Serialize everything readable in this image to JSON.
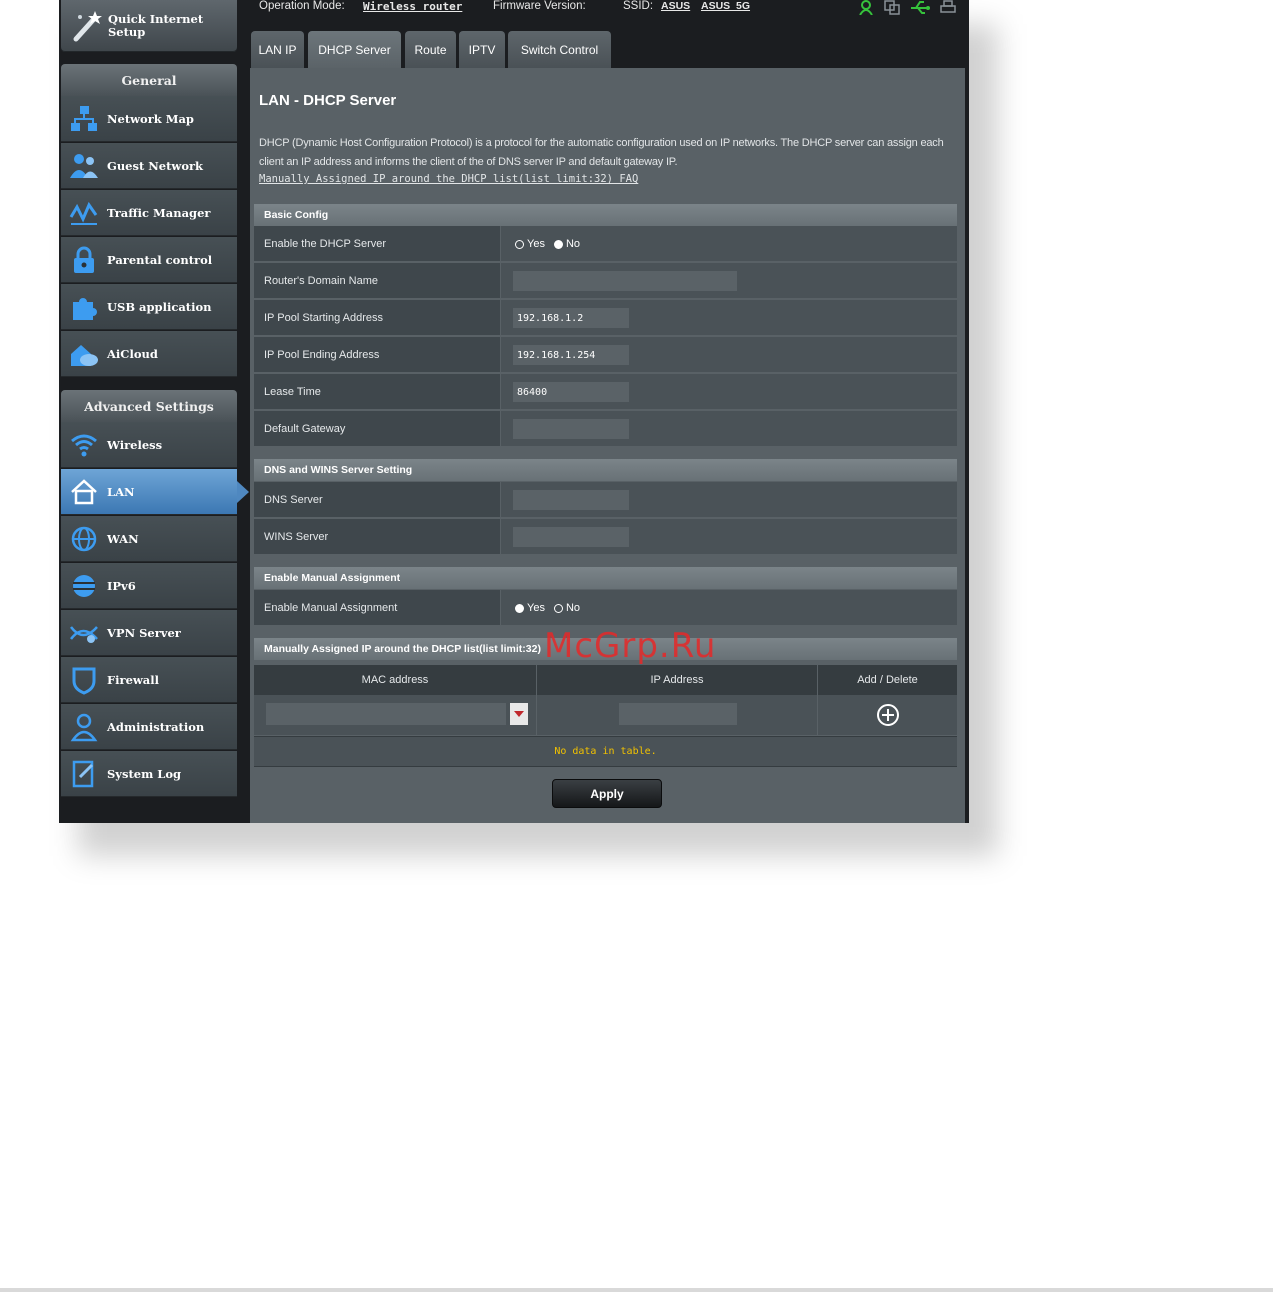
{
  "status_bar": {
    "operation_mode_label": "Operation Mode:",
    "operation_mode_value": "Wireless router",
    "firmware_label": "Firmware Version:",
    "ssid_label": "SSID:",
    "ssid_1": "ASUS",
    "ssid_2": "ASUS_5G",
    "icons": [
      "user-status-icon",
      "copy-status-icon",
      "usb-status-icon",
      "printer-status-icon"
    ],
    "usb_color": "#36c23c"
  },
  "sidebar": {
    "quick_setup_label": "Quick Internet Setup",
    "general_header": "General",
    "general_items": [
      {
        "label": "Network Map",
        "icon": "network-map-icon"
      },
      {
        "label": "Guest Network",
        "icon": "guest-network-icon"
      },
      {
        "label": "Traffic Manager",
        "icon": "traffic-manager-icon"
      },
      {
        "label": "Parental control",
        "icon": "lock-icon"
      },
      {
        "label": "USB application",
        "icon": "puzzle-icon"
      },
      {
        "label": "AiCloud",
        "icon": "cloud-icon"
      }
    ],
    "advanced_header": "Advanced Settings",
    "advanced_items": [
      {
        "label": "Wireless",
        "icon": "wireless-icon"
      },
      {
        "label": "LAN",
        "icon": "home-icon",
        "active": true
      },
      {
        "label": "WAN",
        "icon": "globe-icon"
      },
      {
        "label": "IPv6",
        "icon": "ipv6-globe-icon"
      },
      {
        "label": "VPN Server",
        "icon": "vpn-icon"
      },
      {
        "label": "Firewall",
        "icon": "shield-icon"
      },
      {
        "label": "Administration",
        "icon": "admin-user-icon"
      },
      {
        "label": "System Log",
        "icon": "system-log-icon"
      }
    ],
    "active_color": "#4f88c0"
  },
  "tabs": [
    "LAN IP",
    "DHCP Server",
    "Route",
    "IPTV",
    "Switch Control"
  ],
  "active_tab": "DHCP Server",
  "page": {
    "title": "LAN - DHCP Server",
    "description": "DHCP (Dynamic Host Configuration Protocol) is a protocol for the automatic configuration used on IP networks. The DHCP server can assign each client an IP address and informs the client of the of DNS server IP and default gateway IP.",
    "faq_link": "Manually Assigned IP around the DHCP list(list limit:32) FAQ"
  },
  "basic_config": {
    "header": "Basic Config",
    "enable_dhcp": {
      "label": "Enable the DHCP Server",
      "yes": "Yes",
      "no": "No",
      "selected": "No"
    },
    "domain_name": {
      "label": "Router's Domain Name",
      "value": ""
    },
    "pool_start": {
      "label": "IP Pool Starting Address",
      "value": "192.168.1.2"
    },
    "pool_end": {
      "label": "IP Pool Ending Address",
      "value": "192.168.1.254"
    },
    "lease_time": {
      "label": "Lease Time",
      "value": "86400"
    },
    "default_gateway": {
      "label": "Default Gateway",
      "value": ""
    }
  },
  "dns_wins": {
    "header": "DNS and WINS Server Setting",
    "dns": {
      "label": "DNS Server",
      "value": ""
    },
    "wins": {
      "label": "WINS Server",
      "value": ""
    }
  },
  "manual_assignment": {
    "header": "Enable Manual Assignment",
    "enable": {
      "label": "Enable Manual Assignment",
      "yes": "Yes",
      "no": "No",
      "selected": "Yes"
    }
  },
  "manual_list": {
    "header": "Manually Assigned IP around the DHCP list(list limit:32)",
    "columns": [
      "MAC address",
      "IP Address",
      "Add / Delete"
    ],
    "empty_text": "No data in table.",
    "empty_color": "#f2c200"
  },
  "apply_label": "Apply",
  "watermark": "McGrp.Ru"
}
